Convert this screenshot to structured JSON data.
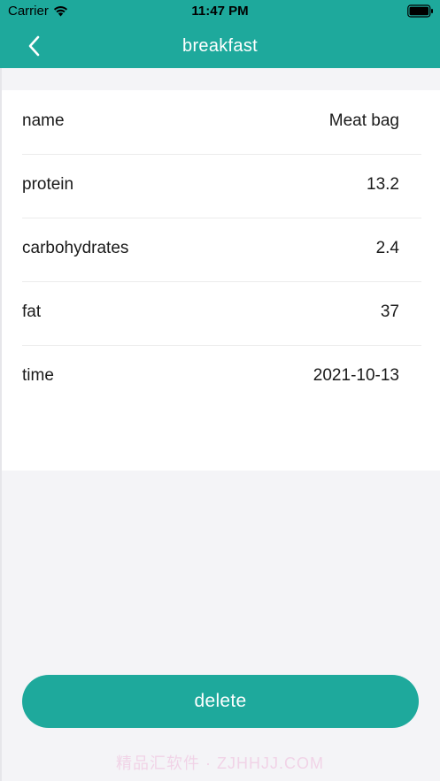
{
  "status_bar": {
    "carrier": "Carrier",
    "time": "11:47 PM"
  },
  "nav": {
    "title": "breakfast",
    "back_icon": "chevron-left-icon"
  },
  "details": [
    {
      "label": "name",
      "value": "Meat bag"
    },
    {
      "label": "protein",
      "value": "13.2"
    },
    {
      "label": "carbohydrates",
      "value": "2.4"
    },
    {
      "label": "fat",
      "value": "37"
    },
    {
      "label": "time",
      "value": "2021-10-13"
    }
  ],
  "actions": {
    "delete_label": "delete"
  },
  "watermark": "精品汇软件 · ZJHHJJ.COM",
  "colors": {
    "accent": "#1ea99c",
    "background": "#f4f4f7",
    "card": "#ffffff",
    "text": "#1a1a1a"
  }
}
